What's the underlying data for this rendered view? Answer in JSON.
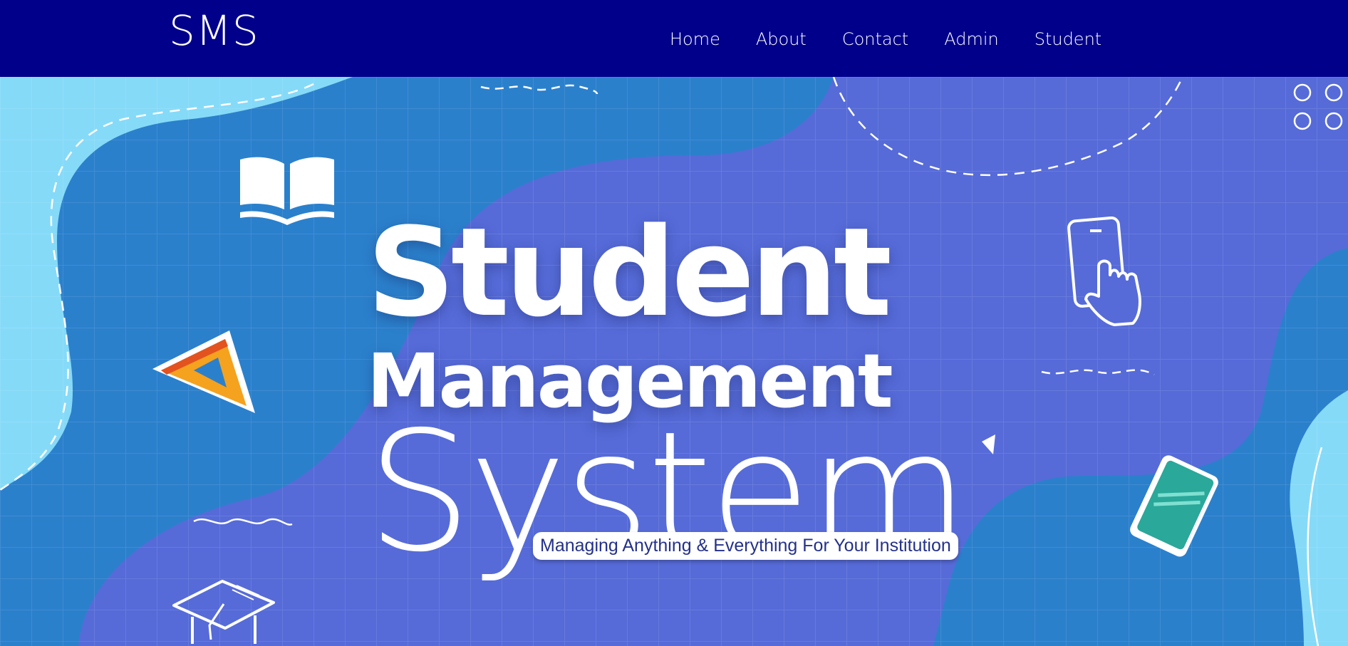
{
  "navbar": {
    "brand": "SMS",
    "links": [
      {
        "label": "Home"
      },
      {
        "label": "About"
      },
      {
        "label": "Contact"
      },
      {
        "label": "Admin"
      },
      {
        "label": "Student"
      }
    ],
    "background": "#00008b"
  },
  "hero": {
    "title_line1": "Student",
    "title_line2": "Management",
    "title_line3": "System",
    "tagline": "Managing Anything & Everything For Your Institution",
    "colors": {
      "background": "#2b80cc",
      "blob_purple": "#566bd8",
      "blob_light": "#85daf8",
      "accent_orange": "#f39c1c",
      "accent_green": "#2aa89a"
    },
    "icons": [
      "open-book-icon",
      "triangle-ruler-icon",
      "touch-phone-icon",
      "green-book-icon",
      "graduation-cap-icon"
    ]
  }
}
